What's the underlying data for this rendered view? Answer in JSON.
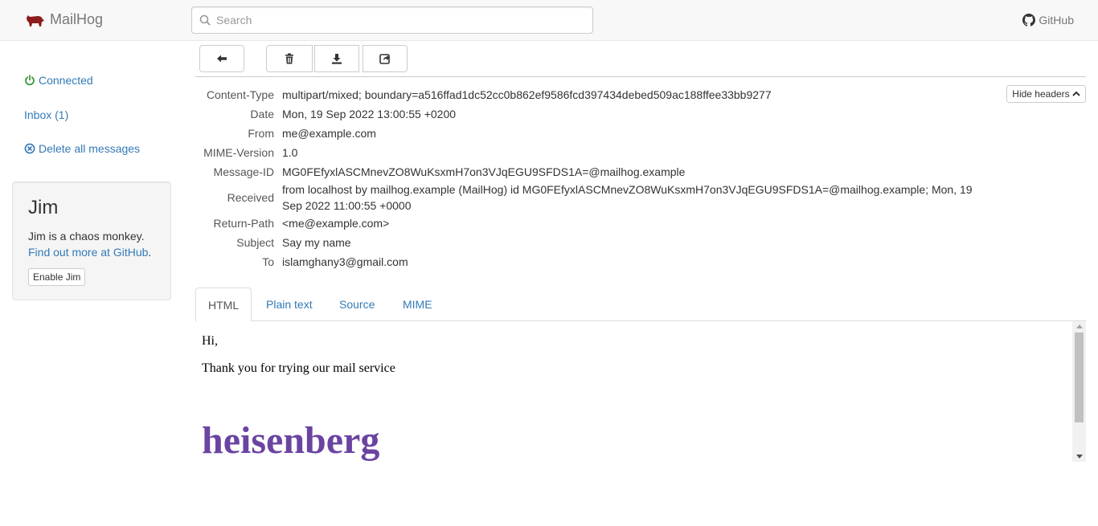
{
  "app": {
    "title": "MailHog",
    "github_label": "GitHub"
  },
  "search": {
    "placeholder": "Search",
    "value": ""
  },
  "sidebar": {
    "connected": "Connected",
    "inbox": "Inbox (1)",
    "delete_all": "Delete all messages",
    "jim": {
      "title": "Jim",
      "text": "Jim is a chaos monkey.",
      "link": "Find out more at GitHub",
      "link_suffix": ".",
      "button": "Enable Jim"
    }
  },
  "message": {
    "hide_headers_label": "Hide headers",
    "headers": [
      {
        "key": "Content-Type",
        "value": "multipart/mixed; boundary=a516ffad1dc52cc0b862ef9586fcd397434debed509ac188ffee33bb9277"
      },
      {
        "key": "Date",
        "value": "Mon, 19 Sep 2022 13:00:55 +0200"
      },
      {
        "key": "From",
        "value": "me@example.com"
      },
      {
        "key": "MIME-Version",
        "value": "1.0"
      },
      {
        "key": "Message-ID",
        "value": "MG0FEfyxlASCMnevZO8WuKsxmH7on3VJqEGU9SFDS1A=@mailhog.example"
      },
      {
        "key": "Received",
        "value": "from localhost by mailhog.example (MailHog) id MG0FEfyxlASCMnevZO8WuKsxmH7on3VJqEGU9SFDS1A=@mailhog.example; Mon, 19 Sep 2022 11:00:55 +0000"
      },
      {
        "key": "Return-Path",
        "value": "<me@example.com>"
      },
      {
        "key": "Subject",
        "value": "Say my name"
      },
      {
        "key": "To",
        "value": "islamghany3@gmail.com"
      }
    ],
    "tabs": [
      "HTML",
      "Plain text",
      "Source",
      "MIME"
    ],
    "active_tab": "HTML",
    "body": {
      "greeting": "Hi,",
      "line": "Thank you for trying our mail service",
      "heading": "heisenberg"
    }
  },
  "colors": {
    "brand_logo": "#8b1c1c",
    "link": "#337ab7",
    "connected": "#3c9a3c",
    "heading": "#6b44a2"
  }
}
